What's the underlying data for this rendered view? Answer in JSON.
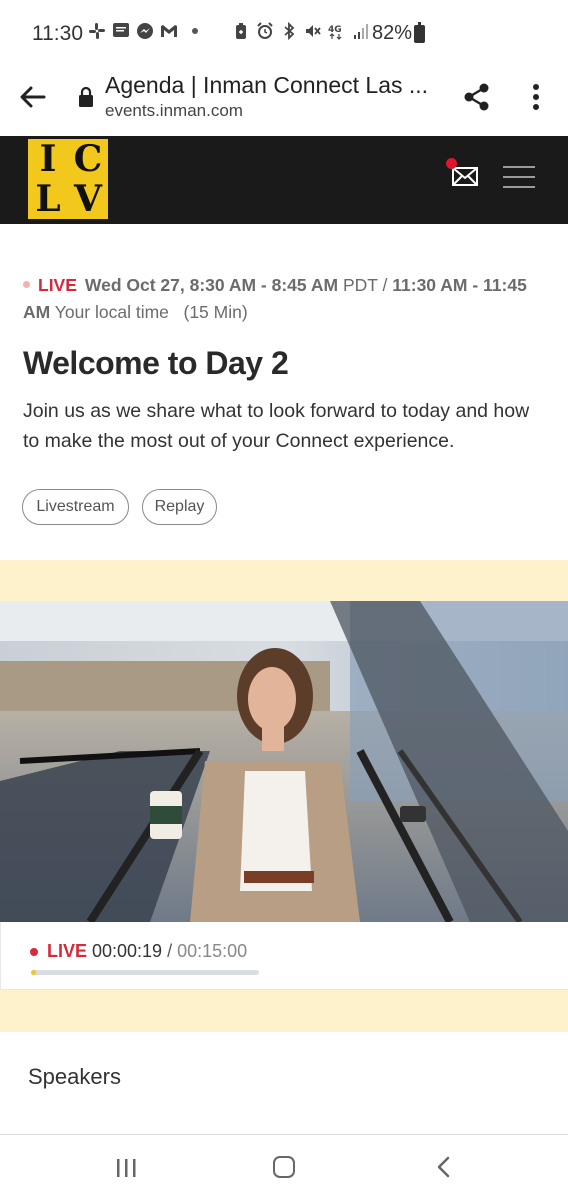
{
  "status_bar": {
    "time": "11:30",
    "battery": "82%",
    "icons": [
      "slack-icon",
      "message-icon",
      "messenger-icon",
      "gmail-icon",
      "dot-icon",
      "battery-saver-icon",
      "alarm-icon",
      "bluetooth-icon",
      "mute-icon",
      "4g-lte-icon",
      "signal-icon",
      "battery-icon"
    ]
  },
  "browser": {
    "title": "Agenda | Inman Connect Las ...",
    "host": "events.inman.com"
  },
  "site_header": {
    "logo_letters": [
      "I",
      "C",
      "L",
      "V"
    ],
    "accent": "#f2c81d",
    "notification_color": "#e0142f"
  },
  "event": {
    "live_label": "LIVE",
    "date_time": "Wed Oct 27, 8:30 AM - 8:45 AM",
    "tz": "PDT /",
    "local_time": "11:30 AM - 11:45 AM",
    "local_label": "Your local time",
    "duration": "(15 Min)",
    "title": "Welcome to Day 2",
    "description": "Join us as we share what to look forward to today and how to make the most out of your Connect experience.",
    "buttons": [
      "Livestream",
      "Replay"
    ]
  },
  "video": {
    "live_label": "LIVE",
    "current_time": "00:00:19",
    "separator": "/",
    "total_time": "00:15:00",
    "progress": 0.021
  },
  "speakers_heading": "Speakers"
}
